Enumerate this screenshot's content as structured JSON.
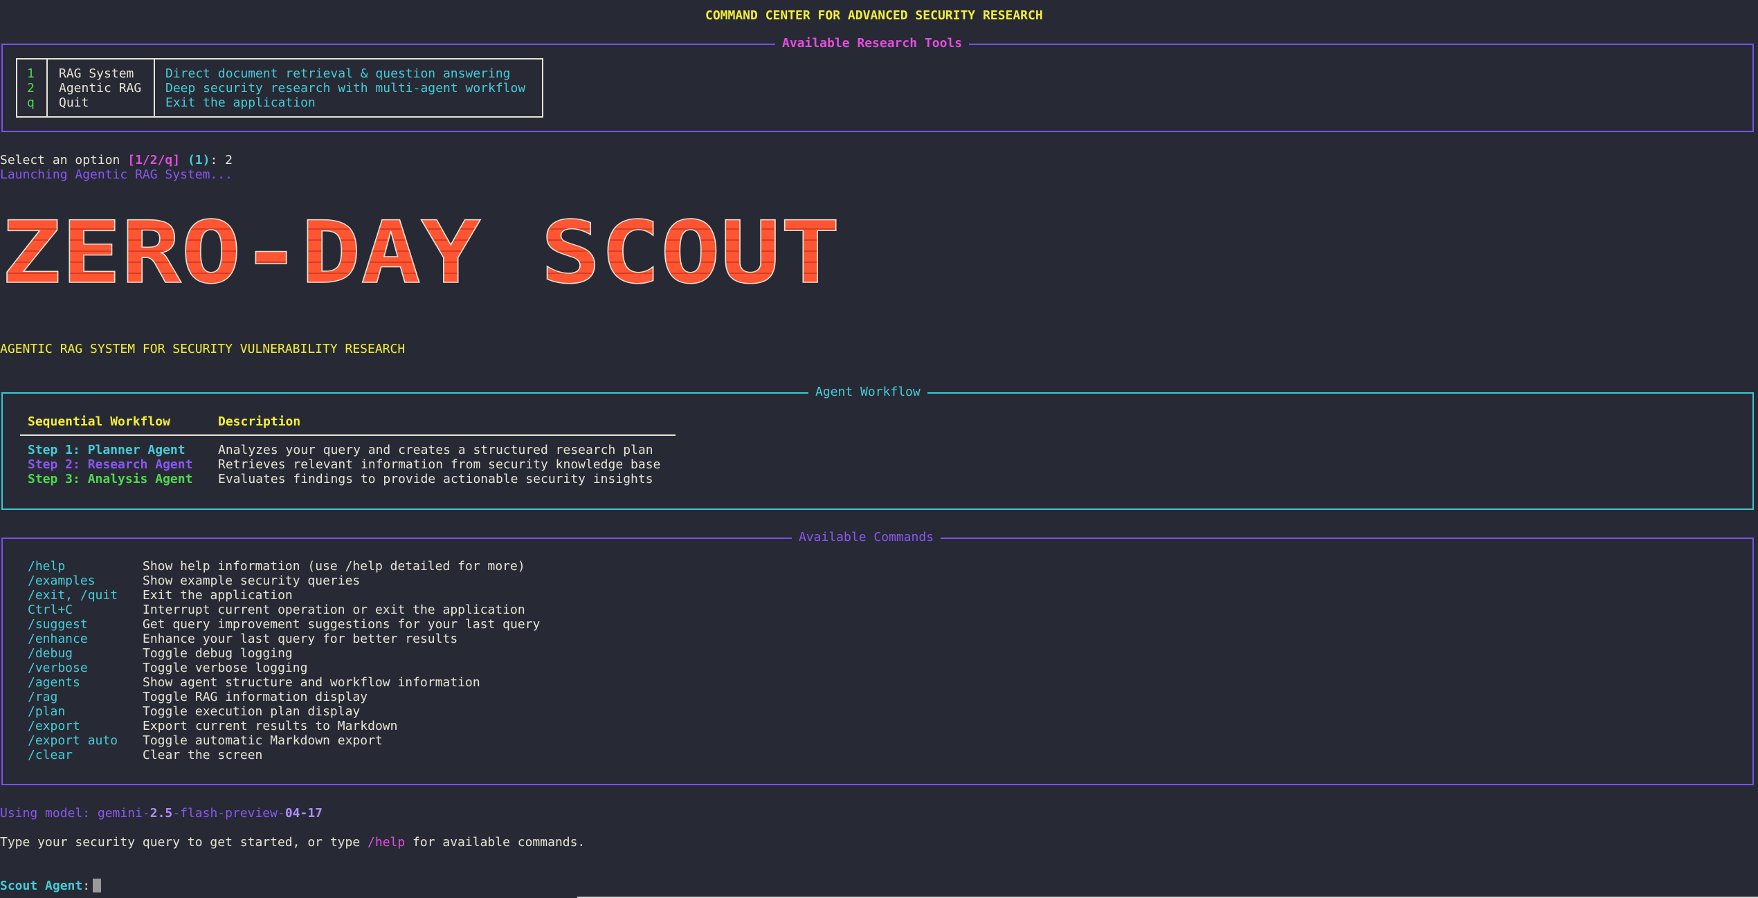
{
  "header": {
    "title": "COMMAND CENTER FOR ADVANCED SECURITY RESEARCH"
  },
  "tools_panel": {
    "title": "Available Research Tools",
    "rows": [
      {
        "key": "1",
        "name": "RAG System",
        "description": "Direct document retrieval & question answering"
      },
      {
        "key": "2",
        "name": "Agentic RAG",
        "description": "Deep security research with multi-agent workflow"
      },
      {
        "key": "q",
        "name": "Quit",
        "description": "Exit the application"
      }
    ]
  },
  "prompt_select": {
    "text": "Select an option ",
    "choices": "[1/2/q]",
    "default": "(1)",
    "suffix": ": 2"
  },
  "launching_text": "Launching Agentic RAG System...",
  "banner": {
    "text": "ZERO-DAY SCOUT",
    "color": "#ff5533"
  },
  "subtitle": "AGENTIC RAG SYSTEM FOR SECURITY VULNERABILITY RESEARCH",
  "workflow_panel": {
    "title": "Agent Workflow",
    "col_workflow": "Sequential Workflow",
    "col_description": "Description",
    "steps": [
      {
        "label": "Step 1: Planner Agent",
        "description": "Analyzes your query and creates a structured research plan",
        "color": "#45cdd8"
      },
      {
        "label": "Step 2: Research Agent",
        "description": "Retrieves relevant information from security knowledge base",
        "color": "#8a56f2"
      },
      {
        "label": "Step 3: Analysis Agent",
        "description": "Evaluates findings to provide actionable security insights",
        "color": "#4fda4f"
      }
    ]
  },
  "commands_panel": {
    "title": "Available Commands",
    "commands": [
      {
        "name": "/help",
        "description": "Show help information (use /help detailed for more)"
      },
      {
        "name": "/examples",
        "description": "Show example security queries"
      },
      {
        "name": "/exit, /quit",
        "description": "Exit the application"
      },
      {
        "name": "Ctrl+C",
        "description": "Interrupt current operation or exit the application"
      },
      {
        "name": "/suggest",
        "description": "Get query improvement suggestions for your last query"
      },
      {
        "name": "/enhance",
        "description": "Enhance your last query for better results"
      },
      {
        "name": "/debug",
        "description": "Toggle debug logging"
      },
      {
        "name": "/verbose",
        "description": "Toggle verbose logging"
      },
      {
        "name": "/agents",
        "description": "Show agent structure and workflow information"
      },
      {
        "name": "/rag",
        "description": "Toggle RAG information display"
      },
      {
        "name": "/plan",
        "description": "Toggle execution plan display"
      },
      {
        "name": "/export",
        "description": "Export current results to Markdown"
      },
      {
        "name": "/export auto",
        "description": "Toggle automatic Markdown export"
      },
      {
        "name": "/clear",
        "description": "Clear the screen"
      }
    ]
  },
  "model_line": {
    "prefix": "Using model: gemini-",
    "version": "2.5",
    "middle": "-flash-preview-",
    "date": "04-17"
  },
  "hint_line": {
    "before": "Type your security query to get started, or type ",
    "command": "/help",
    "after": " for available commands."
  },
  "input_prompt": {
    "label": "Scout Agent",
    "colon": ":",
    "value": ""
  }
}
